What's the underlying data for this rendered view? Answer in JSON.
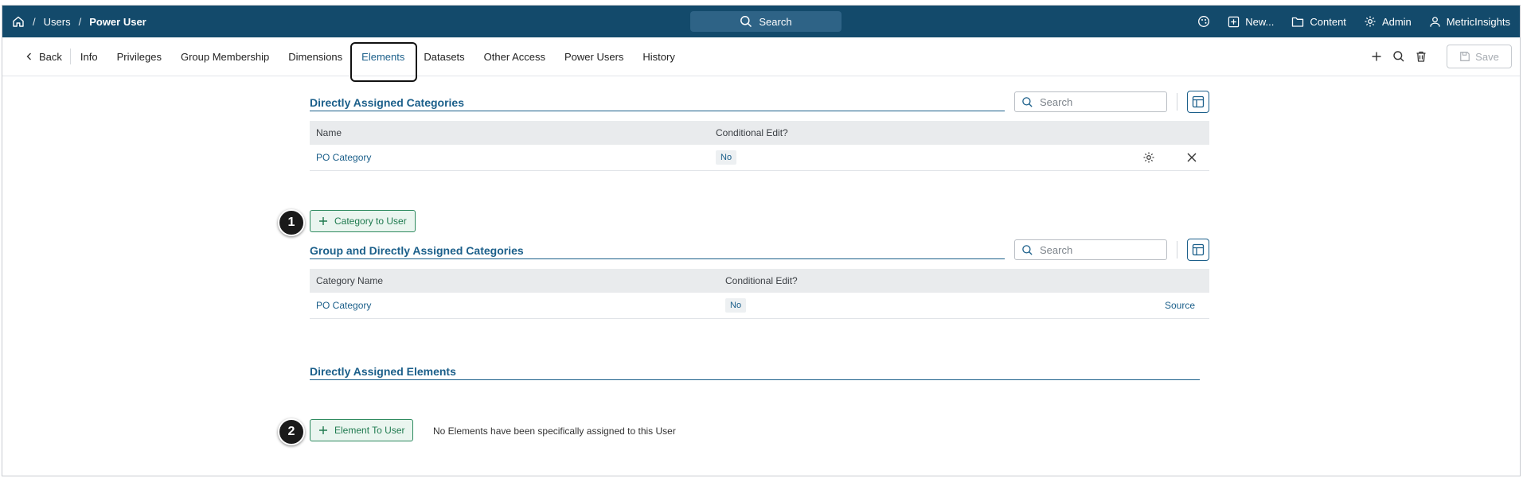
{
  "header": {
    "breadcrumb": [
      "Users",
      "Power User"
    ],
    "search_label": "Search",
    "menu": [
      {
        "label": "New...",
        "icon": "plus-square-icon"
      },
      {
        "label": "Content",
        "icon": "folder-icon"
      },
      {
        "label": "Admin",
        "icon": "gear-icon"
      },
      {
        "label": "MetricInsights",
        "icon": "user-icon"
      }
    ]
  },
  "tabs": {
    "back_label": "Back",
    "items": [
      "Info",
      "Privileges",
      "Group Membership",
      "Dimensions",
      "Elements",
      "Datasets",
      "Other Access",
      "Power Users",
      "History"
    ],
    "active": "Elements",
    "save_label": "Save"
  },
  "sections": {
    "direct_categories": {
      "title": "Directly Assigned Categories",
      "search_placeholder": "Search",
      "columns": [
        "Name",
        "Conditional Edit?"
      ],
      "rows": [
        {
          "name": "PO Category",
          "conditional_edit": "No"
        }
      ],
      "add_button": "Category to User",
      "callout": "1"
    },
    "group_categories": {
      "title": "Group and Directly Assigned Categories",
      "search_placeholder": "Search",
      "columns": [
        "Category Name",
        "Conditional Edit?"
      ],
      "rows": [
        {
          "name": "PO Category",
          "conditional_edit": "No",
          "source": "Source"
        }
      ]
    },
    "direct_elements": {
      "title": "Directly Assigned Elements",
      "add_button": "Element To User",
      "empty_message": "No Elements have been specifically assigned to this User",
      "callout": "2"
    }
  },
  "colors": {
    "header_bg": "#134a6b",
    "accent": "#1b5f8a",
    "add_button_border": "#2e8a5f",
    "add_button_bg": "#eaf5ef"
  }
}
